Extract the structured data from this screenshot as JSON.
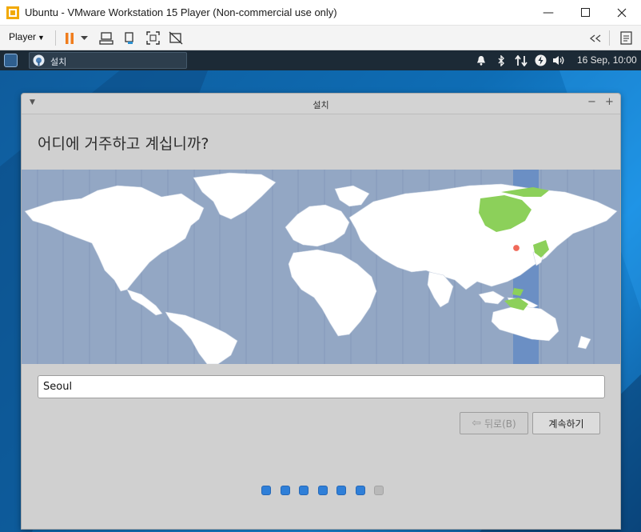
{
  "vmware": {
    "title": "Ubuntu - VMware Workstation 15 Player (Non-commercial use only)",
    "window_controls": [
      "minimize-icon",
      "maximize-icon",
      "close-icon"
    ],
    "toolbar": {
      "player_label": "Player",
      "icons": [
        "pause-icon",
        "dropdown-icon",
        "send-ctrl-alt-del-icon",
        "removable-devices-icon",
        "fullscreen-icon",
        "unity-icon"
      ],
      "right_icons": [
        "collapse-library-icon",
        "notes-icon"
      ]
    }
  },
  "panel": {
    "task_label": "설치",
    "clock": "16 Sep, 10:00",
    "tray_icons": [
      "notification-bell-icon",
      "bluetooth-icon",
      "network-icon",
      "power-icon",
      "volume-icon"
    ]
  },
  "installer": {
    "window_title": "설치",
    "question": "어디에 거주하고 계십니까?",
    "city_value": "Seoul",
    "back_label": "뒤로(B)",
    "next_label": "계속하기",
    "progress": {
      "total": 7,
      "completed": 6
    },
    "colors": {
      "map_ocean": "#93a7c4",
      "selected_zone": "#6b8fc4",
      "highlight": "#8cd05a",
      "dot_done": "#2f7fd8",
      "dot_todo": "#b9b9b9"
    }
  }
}
